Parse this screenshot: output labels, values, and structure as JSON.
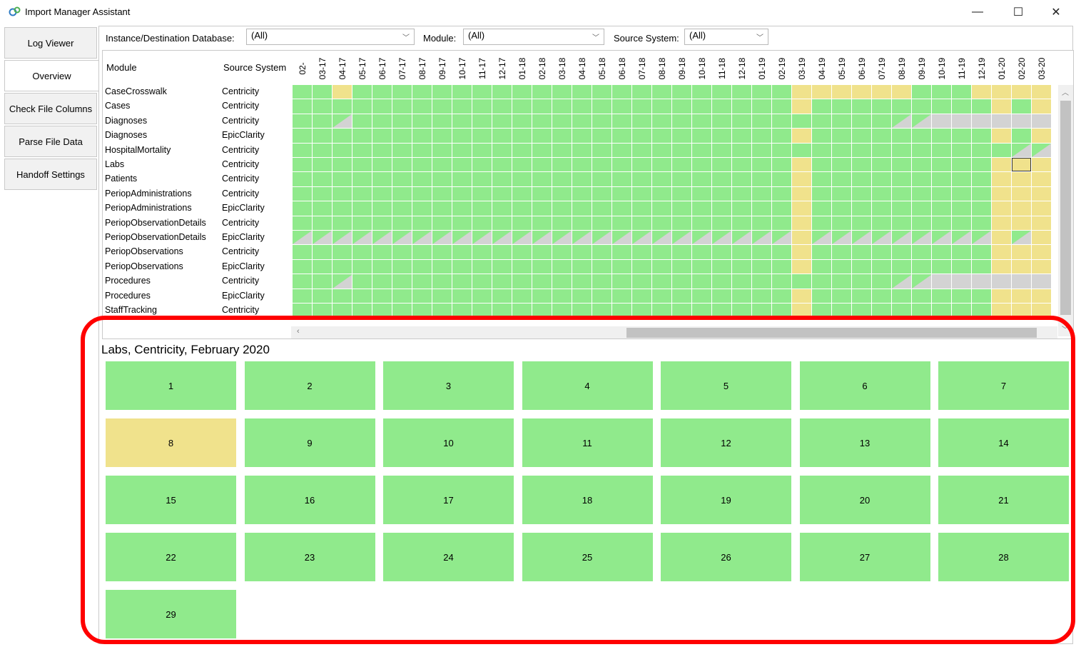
{
  "app": {
    "title": "Import Manager Assistant",
    "minimize": "—",
    "maximize": "☐",
    "close": "✕"
  },
  "sidebar": {
    "items": [
      {
        "label": "Log Viewer"
      },
      {
        "label": "Overview"
      },
      {
        "label": "Check File Columns"
      },
      {
        "label": "Parse File Data"
      },
      {
        "label": "Handoff Settings"
      }
    ],
    "active": "Overview"
  },
  "filters": {
    "database_label": "Instance/Destination Database:",
    "database_value": "(All)",
    "module_label": "Module:",
    "module_value": "(All)",
    "source_label": "Source System:",
    "source_value": "(All)"
  },
  "grid": {
    "col_module": "Module",
    "col_source": "Source System",
    "months": [
      "02-",
      "03-17",
      "04-17",
      "05-17",
      "06-17",
      "07-17",
      "08-17",
      "09-17",
      "10-17",
      "11-17",
      "12-17",
      "01-18",
      "02-18",
      "03-18",
      "04-18",
      "05-18",
      "06-18",
      "07-18",
      "08-18",
      "09-18",
      "10-18",
      "11-18",
      "12-18",
      "01-19",
      "02-19",
      "03-19",
      "04-19",
      "05-19",
      "06-19",
      "07-19",
      "08-19",
      "09-19",
      "10-19",
      "11-19",
      "12-19",
      "01-20",
      "02-20",
      "03-20"
    ],
    "rows": [
      {
        "module": "CaseCrosswalk",
        "source": "Centricity",
        "status": "GGYGGGGGGGGGGGGGGGGGGGGGGYYYYYYGGGYYYY"
      },
      {
        "module": "Cases",
        "source": "Centricity",
        "status": "GGGGGGGGGGGGGGGGGGGGGGGGGYGGGGGGGGGYGY"
      },
      {
        "module": "Diagnoses",
        "source": "Centricity",
        "status": "GGTGGGGGGGGGGGGGGGGGGGGGGGGGGGTTXXXXXX"
      },
      {
        "module": "Diagnoses",
        "source": "EpicClarity",
        "status": "GGGGGGGGGGGGGGGGGGGGGGGGGYGGGGGGGGGYGY"
      },
      {
        "module": "HospitalMortality",
        "source": "Centricity",
        "status": "GGGGGGGGGGGGGGGGGGGGGGGGGGGGGGGGGGGGTT"
      },
      {
        "module": "Labs",
        "source": "Centricity",
        "status": "GGGGGGGGGGGGGGGGGGGGGGGGGYGGGGGGGGGYSY"
      },
      {
        "module": "Patients",
        "source": "Centricity",
        "status": "GGGGGGGGGGGGGGGGGGGGGGGGGYGGGGGGGGGYYY"
      },
      {
        "module": "PeriopAdministrations",
        "source": "Centricity",
        "status": "GGGGGGGGGGGGGGGGGGGGGGGGGYGGGGGGGGGYYY"
      },
      {
        "module": "PeriopAdministrations",
        "source": "EpicClarity",
        "status": "GGGGGGGGGGGGGGGGGGGGGGGGGYGGGGGGGGGYYY"
      },
      {
        "module": "PeriopObservationDetails",
        "source": "Centricity",
        "status": "GGGGGGGGGGGGGGGGGGGGGGGGGYGGGGGGGGGYYY"
      },
      {
        "module": "PeriopObservationDetails",
        "source": "EpicClarity",
        "status": "TTTTTTTTTTTTTTTTTTTTTTTTTYTTTTTTTTTYTY"
      },
      {
        "module": "PeriopObservations",
        "source": "Centricity",
        "status": "GGGGGGGGGGGGGGGGGGGGGGGGGYGGGGGGGGGYYY"
      },
      {
        "module": "PeriopObservations",
        "source": "EpicClarity",
        "status": "GGGGGGGGGGGGGGGGGGGGGGGGGYGGGGGGGGGYYY"
      },
      {
        "module": "Procedures",
        "source": "Centricity",
        "status": "GGTGGGGGGGGGGGGGGGGGGGGGGGGGGGTTXXXXXX"
      },
      {
        "module": "Procedures",
        "source": "EpicClarity",
        "status": "GGGGGGGGGGGGGGGGGGGGGGGGGYGGGGGGGGGYYY"
      },
      {
        "module": "StaffTracking",
        "source": "Centricity",
        "status": "GGGGGGGGGGGGGGGGGGGGGGGGGYGGGGGGGGGYYY"
      }
    ]
  },
  "detail": {
    "title": "Labs, Centricity, February 2020",
    "days": [
      {
        "label": "1",
        "status": "ok"
      },
      {
        "label": "2",
        "status": "ok"
      },
      {
        "label": "3",
        "status": "ok"
      },
      {
        "label": "4",
        "status": "ok"
      },
      {
        "label": "5",
        "status": "ok"
      },
      {
        "label": "6",
        "status": "ok"
      },
      {
        "label": "7",
        "status": "ok"
      },
      {
        "label": "8",
        "status": "warning"
      },
      {
        "label": "9",
        "status": "ok"
      },
      {
        "label": "10",
        "status": "ok"
      },
      {
        "label": "11",
        "status": "ok"
      },
      {
        "label": "12",
        "status": "ok"
      },
      {
        "label": "13",
        "status": "ok"
      },
      {
        "label": "14",
        "status": "ok"
      },
      {
        "label": "15",
        "status": "ok"
      },
      {
        "label": "16",
        "status": "ok"
      },
      {
        "label": "17",
        "status": "ok"
      },
      {
        "label": "18",
        "status": "ok"
      },
      {
        "label": "19",
        "status": "ok"
      },
      {
        "label": "20",
        "status": "ok"
      },
      {
        "label": "21",
        "status": "ok"
      },
      {
        "label": "22",
        "status": "ok"
      },
      {
        "label": "23",
        "status": "ok"
      },
      {
        "label": "24",
        "status": "ok"
      },
      {
        "label": "25",
        "status": "ok"
      },
      {
        "label": "26",
        "status": "ok"
      },
      {
        "label": "27",
        "status": "ok"
      },
      {
        "label": "28",
        "status": "ok"
      },
      {
        "label": "29",
        "status": "ok"
      }
    ]
  },
  "colors": {
    "ok": "#90ea8c",
    "warning": "#f0e28c",
    "missing": "#d3d3d3",
    "highlight": "#ff0000"
  }
}
